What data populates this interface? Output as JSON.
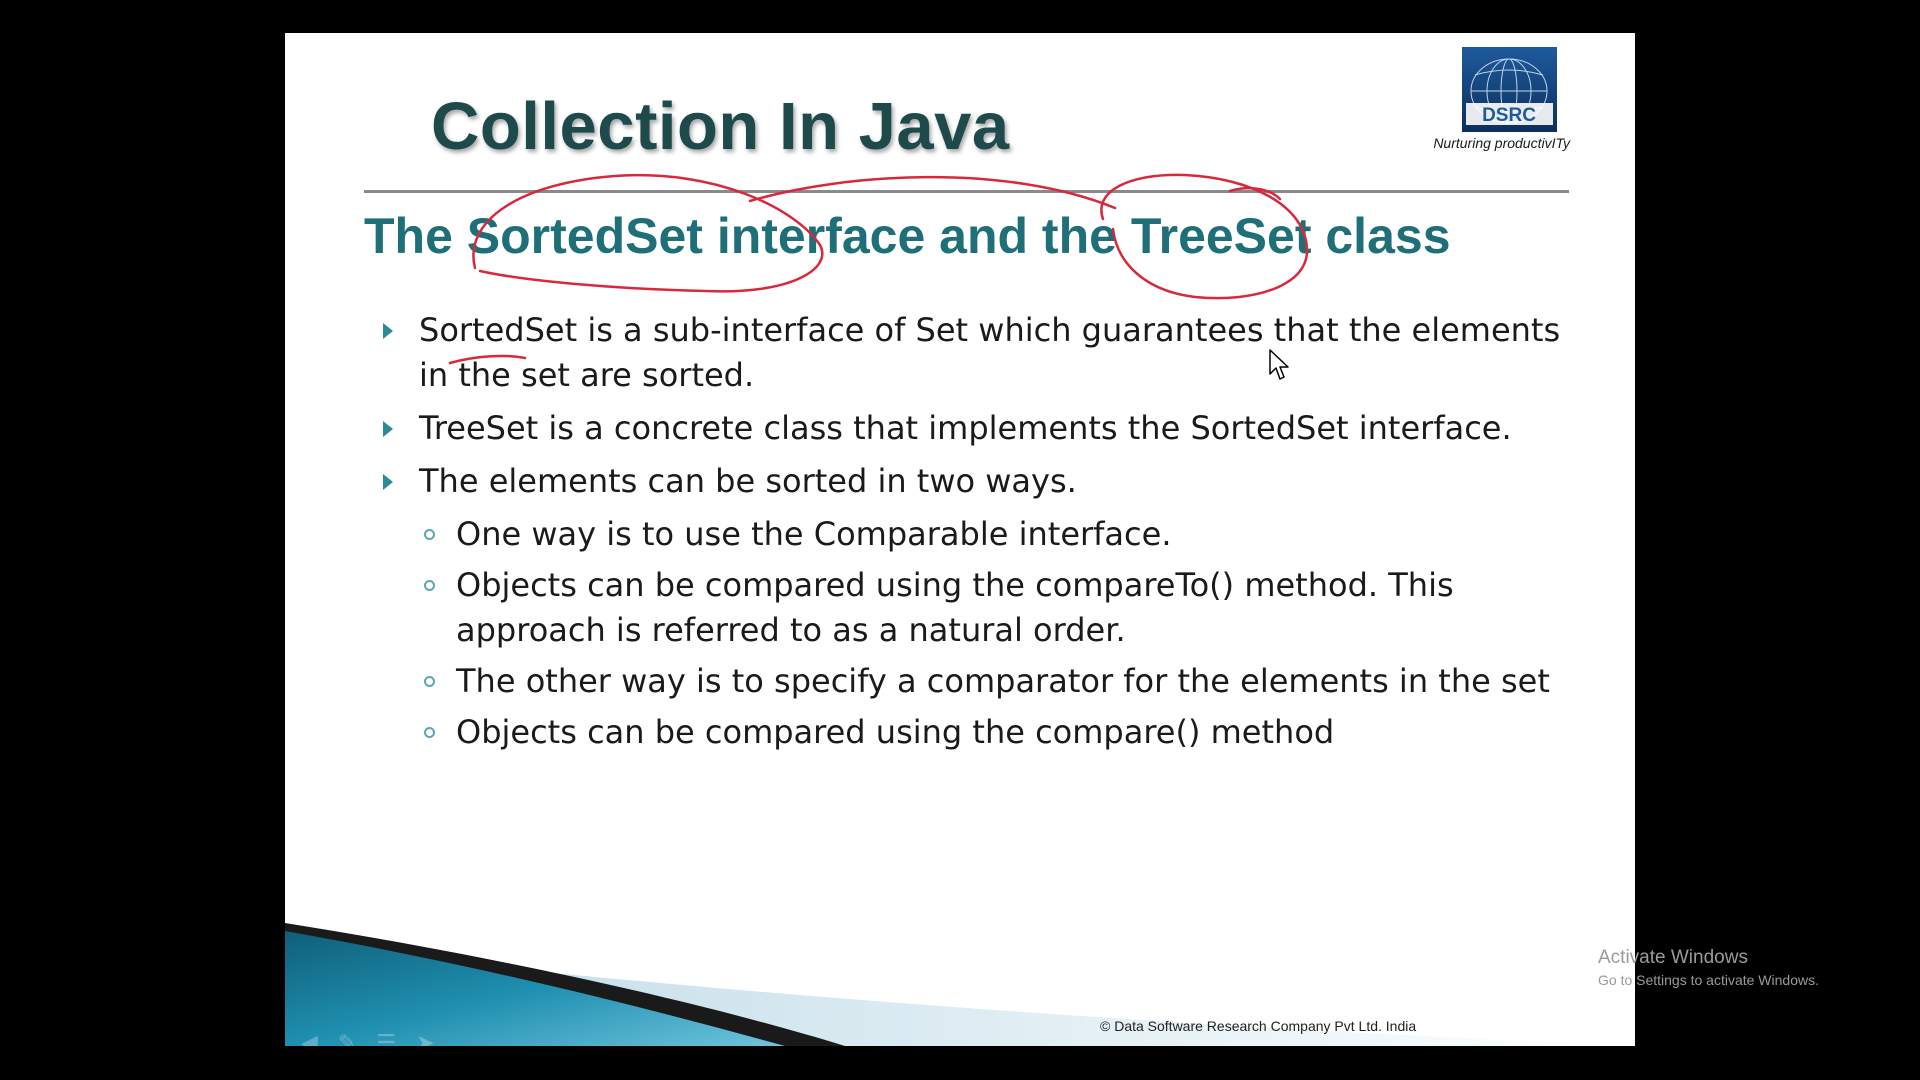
{
  "slide": {
    "title": "Collection In Java",
    "subtitle": "The SortedSet interface and the TreeSet class",
    "logo_text": "DSRC",
    "logo_tagline": "Nurturing productivITy",
    "copyright": "© Data Software Research Company Pvt Ltd. India",
    "bullets": [
      {
        "level": 1,
        "text": "SortedSet is a sub-interface of Set which guarantees that the elements in the set are sorted."
      },
      {
        "level": 1,
        "text": "TreeSet is a concrete class that implements the SortedSet interface."
      },
      {
        "level": 1,
        "text": "The elements can be sorted in two ways."
      },
      {
        "level": 2,
        "text": "One way is to use the Comparable interface."
      },
      {
        "level": 2,
        "text": "Objects can be compared using the compareTo() method. This approach is referred to as a natural order."
      },
      {
        "level": 2,
        "text": "The other way is to specify a comparator for the elements in the set"
      },
      {
        "level": 2,
        "text": "Objects can be compared using the compare() method"
      }
    ]
  },
  "watermark": {
    "title": "Activate Windows",
    "subtitle": "Go to Settings to activate Windows."
  },
  "colors": {
    "title": "#1f4a4c",
    "subtitle": "#1f6f78",
    "bullet_marker": "#2c8a96",
    "annotation_ink": "#d8283c",
    "wave_teal": "#1f8fb0",
    "logo_blue": "#1e5a9c"
  },
  "icons": {
    "bullet_level1": "triangle-right-icon",
    "bullet_level2": "ring-icon",
    "cursor": "mouse-pointer-icon",
    "nav": [
      "back-arrow-icon",
      "pen-icon",
      "menu-icon",
      "forward-icon"
    ]
  }
}
